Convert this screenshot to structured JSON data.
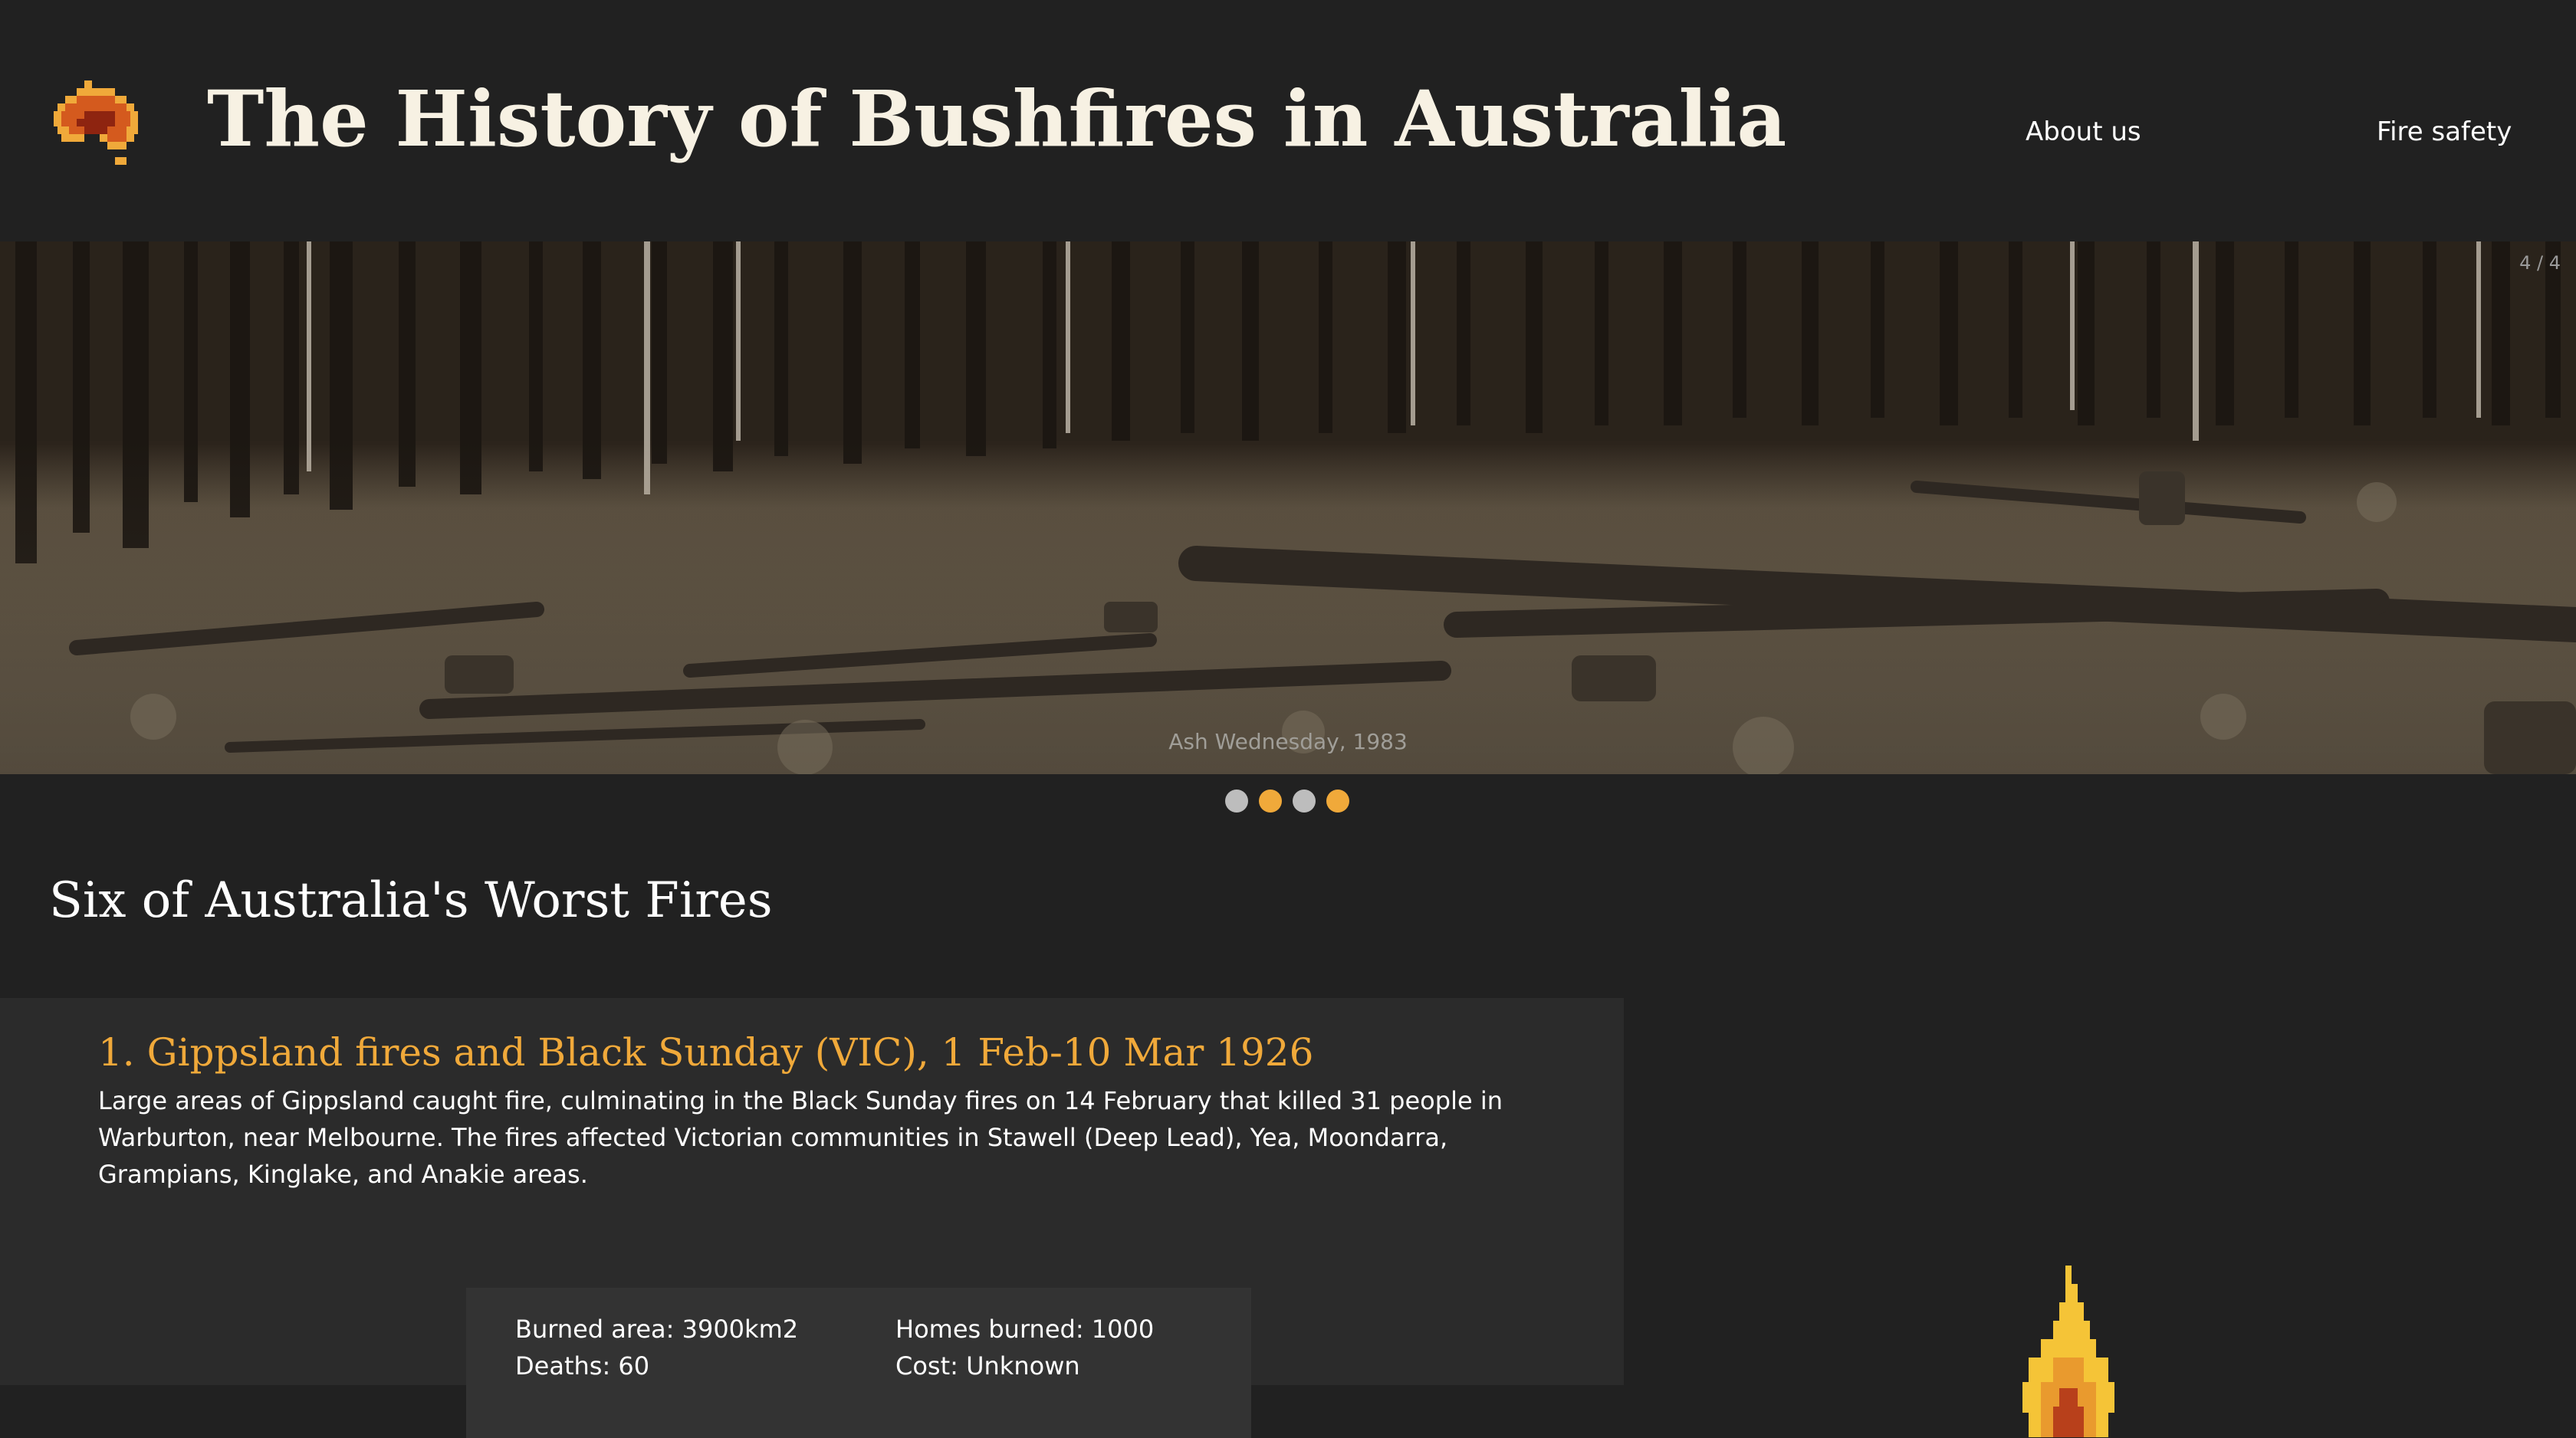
{
  "header": {
    "title": "The History of Bushfires in Australia",
    "nav": [
      {
        "label": "About us"
      },
      {
        "label": "Fire safety"
      }
    ],
    "logo_icon": "australia-map-icon"
  },
  "carousel": {
    "counter": "4 / 4",
    "caption": "Ash Wednesday, 1983",
    "dots": [
      {
        "state": "inactive"
      },
      {
        "state": "active"
      },
      {
        "state": "inactive"
      },
      {
        "state": "active"
      }
    ]
  },
  "section": {
    "heading": "Six of Australia's Worst Fires"
  },
  "fire": {
    "title": "1. Gippsland fires and Black Sunday (VIC), 1 Feb-10 Mar 1926",
    "description": "Large areas of Gippsland caught fire, culminating in the Black Sunday fires on 14 February that killed 31 people in Warburton, near Melbourne. The fires affected Victorian communities in Stawell (Deep Lead), Yea, Moondarra, Grampians, Kinglake, and Anakie areas.",
    "stats": {
      "burned_area": "Burned area: 3900km2",
      "deaths": "Deaths: 60",
      "homes_burned": "Homes burned: 1000",
      "cost": "Cost: Unknown"
    },
    "flame_icon": "flame-icon"
  },
  "colors": {
    "background": "#212121",
    "card": "#2b2b2b",
    "stats_box": "#333333",
    "accent": "#f0a93a",
    "title_text": "#f7f1e3",
    "dot_inactive": "#bdbdbd"
  }
}
